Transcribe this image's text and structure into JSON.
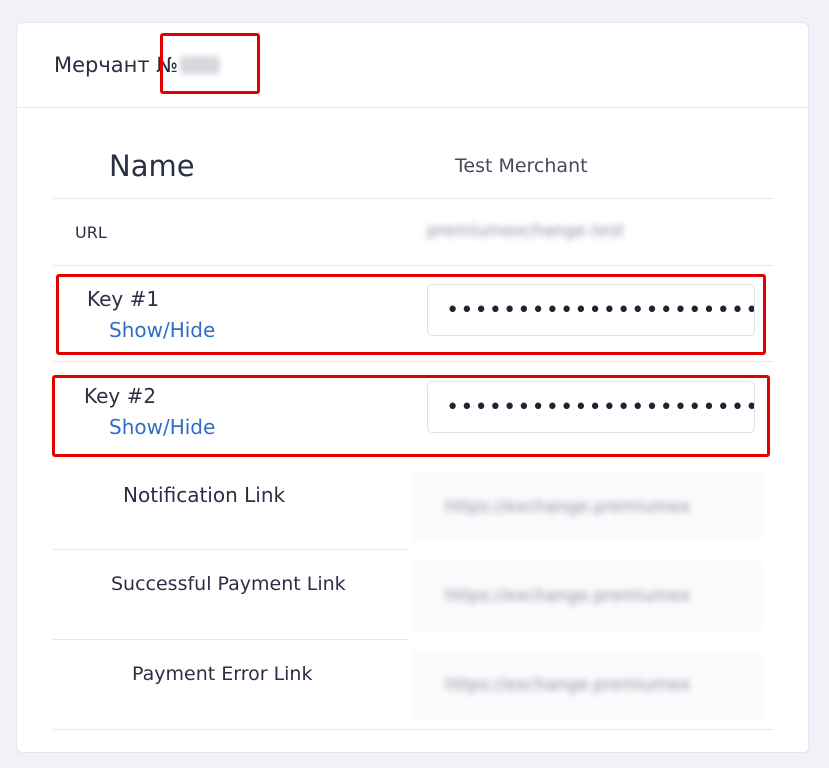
{
  "header": {
    "title": "Мерчант №"
  },
  "rows": {
    "name": {
      "label": "Name",
      "value": "Test Merchant"
    },
    "url": {
      "label": "URL",
      "value": "premiumexchange.test"
    },
    "key1": {
      "label": "Key #1",
      "toggle": "Show/Hide",
      "value": "••••••••••••••••••••••••••"
    },
    "key2": {
      "label": "Key #2",
      "toggle": "Show/Hide",
      "value": "••••••••••••••••••••••••••"
    },
    "notification": {
      "label": "Notification Link",
      "value": "https://exchange.premiumex"
    },
    "success": {
      "label": "Successful Payment Link",
      "value": "https://exchange.premiumex"
    },
    "error": {
      "label": "Payment Error Link",
      "value": "https://exchange.premiumex"
    }
  },
  "colors": {
    "accent_link": "#2f6fc4",
    "highlight_red": "#e00000",
    "background": "#f0f2f7"
  }
}
